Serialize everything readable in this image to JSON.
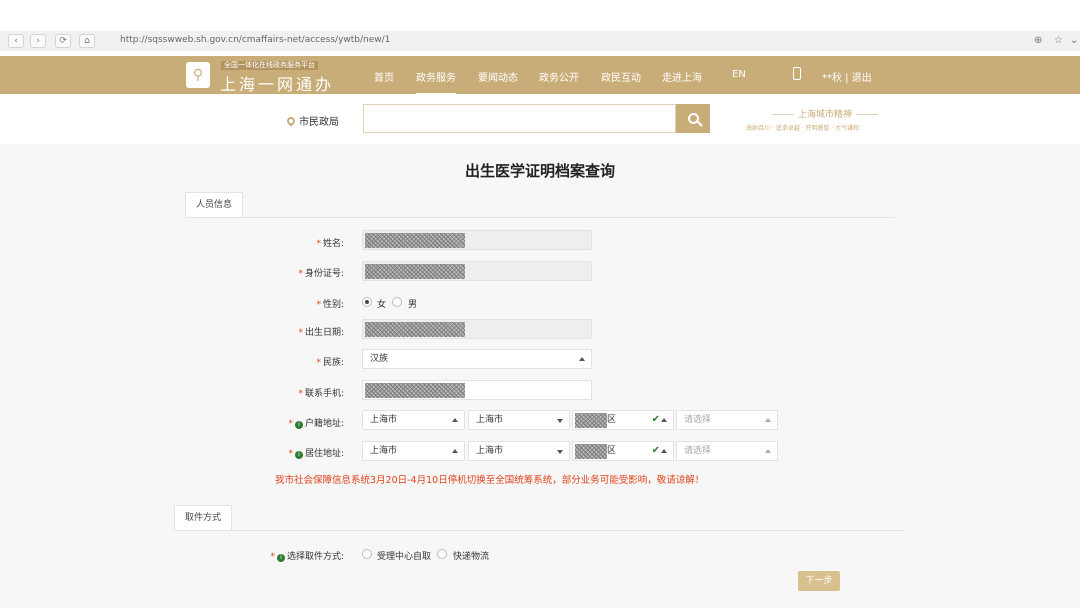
{
  "browser": {
    "back": "‹",
    "forward": "›",
    "reload": "⟳",
    "home": "⌂",
    "url": "http://sqsswweb.sh.gov.cn/cmaffairs-net/access/ywtb/new/1",
    "zoom_icon": "⊕",
    "star_icon": "☆",
    "menu_icon": "⌄"
  },
  "header": {
    "logo_glyph": "⚲",
    "logo_small": "全国一体化在线政务服务平台",
    "logo_title": "上海一网通办",
    "nav": [
      "首页",
      "政务服务",
      "要闻动态",
      "政务公开",
      "政民互动",
      "走进上海",
      "EN"
    ],
    "user": "**秋  |  退出",
    "accent_color": "#c9ad79"
  },
  "search": {
    "location": "市民政局",
    "placeholder": "",
    "brand_title": "上海城市精神",
    "brand_sub": "海纳百川 · 追求卓越 · 开明睿智 · 大气谦和"
  },
  "page_title": "出生医学证明档案查询",
  "section_person": "人员信息",
  "form": {
    "name_label": "姓名:",
    "id_label": "身份证号:",
    "gender_label": "性别:",
    "gender_female": "女",
    "gender_male": "男",
    "birth_label": "出生日期:",
    "ethnic_label": "民族:",
    "ethnic_value": "汉族",
    "phone_label": "联系手机:",
    "household_label": "户籍地址:",
    "residence_label": "居住地址:",
    "province": "上海市",
    "city": "上海市",
    "district_suffix": "区",
    "street_placeholder": "请选择",
    "required_mark": "*"
  },
  "notice": "我市社会保障信息系统3月20日-4月10日停机切换至全国统筹系统，部分业务可能受影响，敬请谅解！",
  "section_pickup": "取件方式",
  "pickup": {
    "label": "选择取件方式:",
    "option_self": "受理中心自取",
    "option_express": "快递物流"
  },
  "next_button": "下一步"
}
